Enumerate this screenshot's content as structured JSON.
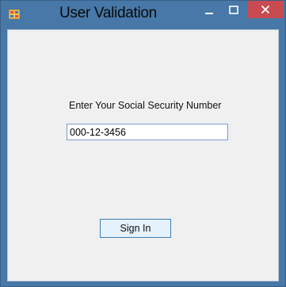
{
  "window": {
    "title": "User Validation",
    "icons": {
      "app": "app-icon",
      "minimize": "minimize-icon",
      "maximize": "maximize-icon",
      "close": "close-icon"
    },
    "colors": {
      "frame": "#4778a8",
      "close_button": "#c74b50",
      "client": "#f0f0f0"
    }
  },
  "form": {
    "prompt": "Enter Your Social Security Number",
    "ssn_value": "000-12-3456",
    "sign_in_label": "Sign In"
  }
}
